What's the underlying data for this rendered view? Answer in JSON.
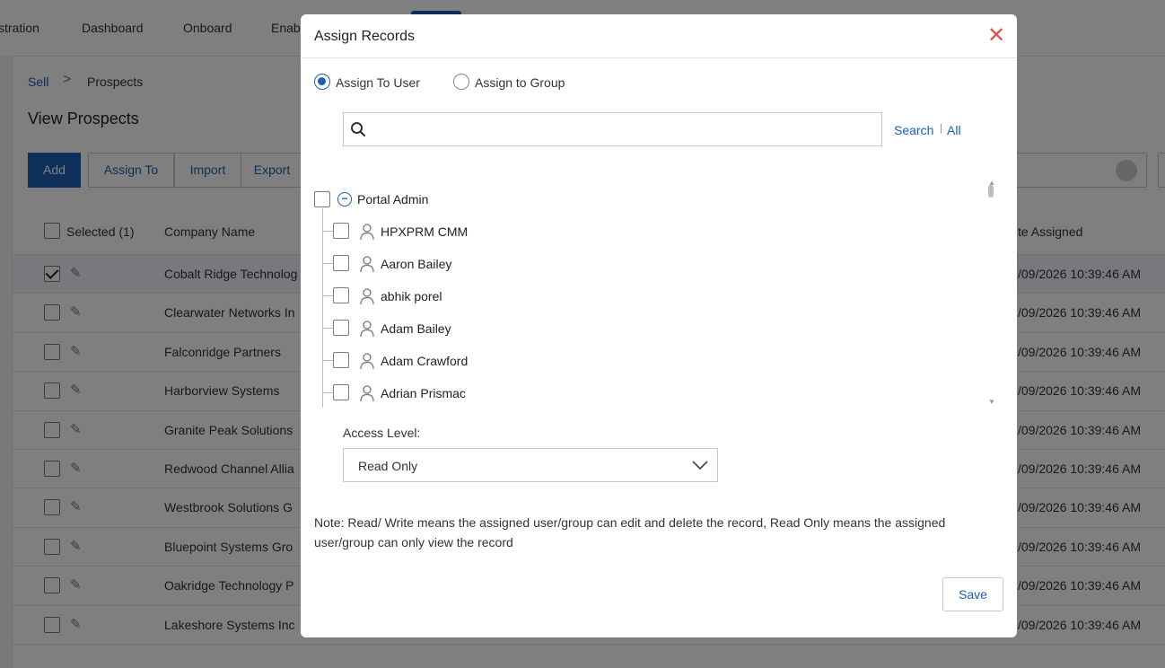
{
  "topnav": {
    "items": [
      "stration",
      "Dashboard",
      "Onboard",
      "Enab"
    ]
  },
  "breadcrumb": {
    "parent": "Sell",
    "separator": ">",
    "current": "Prospects"
  },
  "page": {
    "title": "View Prospects"
  },
  "toolbar": {
    "add": "Add",
    "assign_to": "Assign To",
    "import": "Import",
    "export": "Export"
  },
  "table": {
    "headers": {
      "selected": "Selected (1)",
      "company": "Company Name",
      "date_assigned": "te Assigned"
    },
    "rows": [
      {
        "company": "Cobalt Ridge Technolog",
        "date": "/09/2026 10:39:46 AM",
        "checked": true
      },
      {
        "company": "Clearwater Networks In",
        "date": "/09/2026 10:39:46 AM",
        "checked": false
      },
      {
        "company": "Falconridge Partners",
        "date": "/09/2026 10:39:46 AM",
        "checked": false
      },
      {
        "company": "Harborview Systems",
        "date": "/09/2026 10:39:46 AM",
        "checked": false
      },
      {
        "company": "Granite Peak Solutions",
        "date": "/09/2026 10:39:46 AM",
        "checked": false
      },
      {
        "company": "Redwood Channel Allia",
        "date": "/09/2026 10:39:46 AM",
        "checked": false
      },
      {
        "company": "Westbrook Solutions G",
        "date": "/09/2026 10:39:46 AM",
        "checked": false
      },
      {
        "company": "Bluepoint Systems Gro",
        "date": "/09/2026 10:39:46 AM",
        "checked": false
      },
      {
        "company": "Oakridge Technology P",
        "date": "/09/2026 10:39:46 AM",
        "checked": false
      },
      {
        "company": "Lakeshore Systems Inc",
        "date": "/09/2026 10:39:46 AM",
        "checked": false
      }
    ]
  },
  "modal": {
    "title": "Assign Records",
    "close_icon": "close-icon",
    "radio_user": "Assign To User",
    "radio_group": "Assign to Group",
    "selected_option": "user",
    "search": {
      "value": "",
      "placeholder": "",
      "search_link": "Search",
      "separator": "|",
      "all_link": "All"
    },
    "tree": {
      "root": "Portal Admin",
      "users": [
        "HPXPRM CMM",
        "Aaron Bailey",
        "abhik porel",
        "Adam Bailey",
        "Adam Crawford",
        "Adrian Prismac"
      ]
    },
    "access_level": {
      "label": "Access Level:",
      "value": "Read Only"
    },
    "note": "Note: Read/ Write means the assigned user/group can edit and delete the record, Read Only means the assigned user/group can only view the record",
    "save": "Save"
  },
  "colors": {
    "accent": "#1a5fb4",
    "close": "#d9534f",
    "overlay": "rgba(0,0,0,0.5)"
  }
}
